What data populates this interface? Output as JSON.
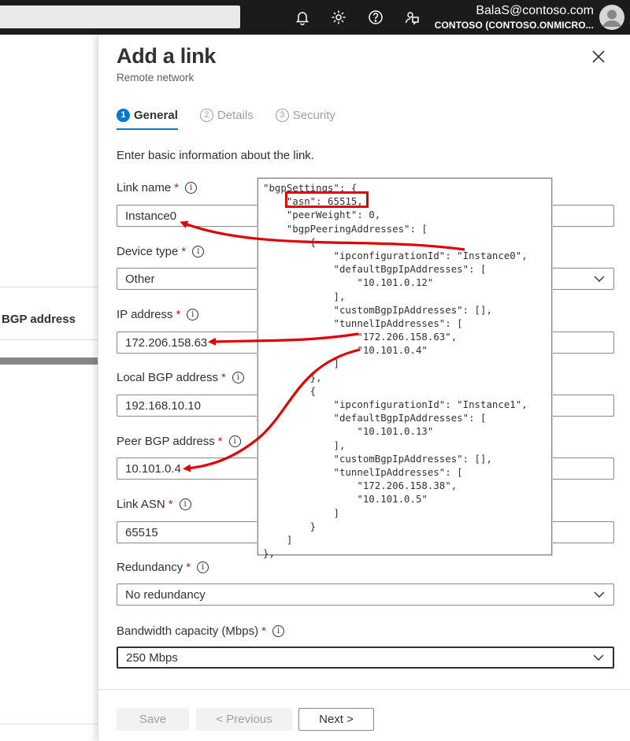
{
  "topbar": {
    "user_email": "BalaS@contoso.com",
    "user_tenant": "CONTOSO (CONTOSO.ONMICRO...",
    "icons": [
      "bell-icon",
      "gear-icon",
      "help-icon",
      "feedback-icon"
    ]
  },
  "background": {
    "column_label": "BGP address"
  },
  "panel": {
    "title": "Add a link",
    "subtitle": "Remote network",
    "tabs": [
      {
        "num": "1",
        "label": "General",
        "active": true
      },
      {
        "num": "2",
        "label": "Details",
        "active": false
      },
      {
        "num": "3",
        "label": "Security",
        "active": false
      }
    ],
    "intro": "Enter basic information about the link.",
    "fields": {
      "link_name": {
        "label": "Link name",
        "value": "Instance0"
      },
      "device_type": {
        "label": "Device type",
        "value": "Other"
      },
      "ip_address": {
        "label": "IP address",
        "value": "172.206.158.63"
      },
      "local_bgp": {
        "label": "Local BGP address",
        "value": "192.168.10.10"
      },
      "peer_bgp": {
        "label": "Peer BGP address",
        "value": "10.101.0.4"
      },
      "link_asn": {
        "label": "Link ASN",
        "value": "65515"
      },
      "redundancy": {
        "label": "Redundancy",
        "value": "No redundancy"
      },
      "bandwidth": {
        "label": "Bandwidth capacity (Mbps)",
        "value": "250 Mbps"
      }
    },
    "required_mark": "*",
    "info_glyph": "i",
    "buttons": {
      "save": "Save",
      "previous": "< Previous",
      "next": "Next >"
    }
  },
  "code_lines": [
    "\"bgpSettings\": {",
    "    \"asn\": 65515,",
    "    \"peerWeight\": 0,",
    "    \"bgpPeeringAddresses\": [",
    "        {",
    "            \"ipconfigurationId\": \"Instance0\",",
    "            \"defaultBgpIpAddresses\": [",
    "                \"10.101.0.12\"",
    "            ],",
    "            \"customBgpIpAddresses\": [],",
    "            \"tunnelIpAddresses\": [",
    "                \"172.206.158.63\",",
    "                \"10.101.0.4\"",
    "            ]",
    "        },",
    "        {",
    "            \"ipconfigurationId\": \"Instance1\",",
    "            \"defaultBgpIpAddresses\": [",
    "                \"10.101.0.13\"",
    "            ],",
    "            \"customBgpIpAddresses\": [],",
    "            \"tunnelIpAddresses\": [",
    "                \"172.206.158.38\",",
    "                \"10.101.0.5\"",
    "            ]",
    "        }",
    "    ]",
    "},"
  ],
  "colors": {
    "accent": "#0078d4",
    "annotation": "#e00000",
    "required": "#a4262c",
    "topbar": "#1b1b1b"
  }
}
